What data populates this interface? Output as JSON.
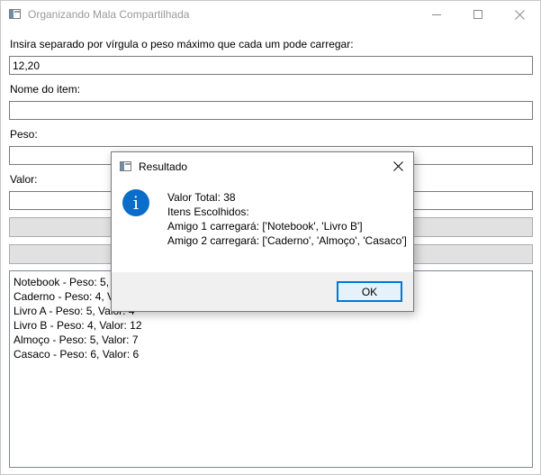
{
  "window": {
    "title": "Organizando Mala Compartilhada"
  },
  "form": {
    "weights_label": "Insira separado por vírgula o peso máximo que cada um pode carregar:",
    "weights_value": "12,20",
    "item_name_label": "Nome do item:",
    "item_name_value": "",
    "weight_label": "Peso:",
    "weight_value": "",
    "value_label": "Valor:",
    "value_value": ""
  },
  "items_list": [
    "Notebook - Peso: 5, Valor: 10",
    "Caderno - Peso: 4, Valor: 8",
    "Livro A - Peso: 5, Valor: 4",
    "Livro B - Peso: 4, Valor: 12",
    "Almoço - Peso: 5, Valor: 7",
    "Casaco - Peso: 6, Valor: 6"
  ],
  "dialog": {
    "title": "Resultado",
    "lines": [
      "Valor Total: 38",
      "Itens Escolhidos:",
      "Amigo 1 carregará: ['Notebook', 'Livro B']",
      "Amigo 2 carregará: ['Caderno', 'Almoço', 'Casaco']"
    ],
    "ok_label": "OK",
    "icon": "info-icon",
    "accent_color": "#0078d7",
    "icon_color": "#0a6dc9"
  }
}
